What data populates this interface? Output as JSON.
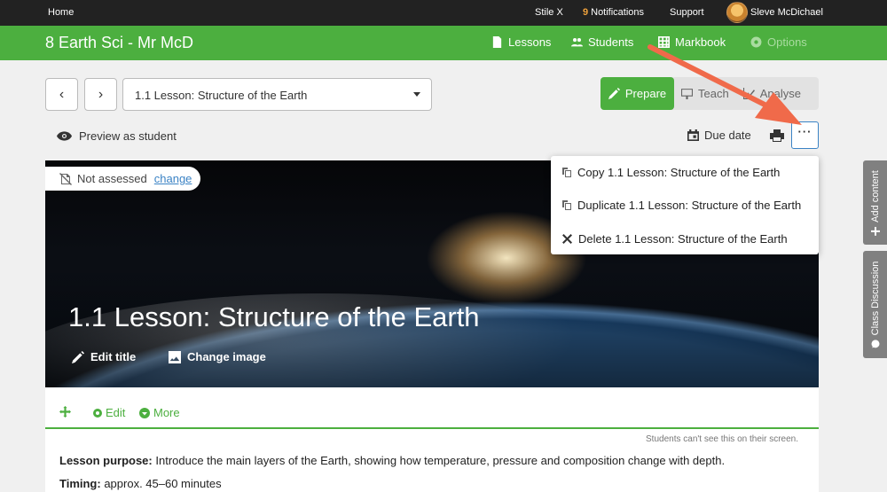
{
  "topbar": {
    "home": "Home",
    "stilex": "Stile X",
    "notif_count": "9",
    "notifications": "Notifications",
    "support": "Support",
    "user": "Sleve McDichael"
  },
  "greenbar": {
    "course": "8 Earth Sci - Mr McD",
    "lessons": "Lessons",
    "students": "Students",
    "markbook": "Markbook",
    "options": "Options"
  },
  "selector": {
    "lesson": "1.1 Lesson: Structure of the Earth",
    "modes": [
      "Prepare",
      "Teach",
      "Analyse"
    ]
  },
  "actions": {
    "preview": "Preview as student",
    "due_date": "Due date",
    "more": "···"
  },
  "menu": {
    "copy": "Copy 1.1 Lesson: Structure of the Earth",
    "duplicate": "Duplicate 1.1 Lesson: Structure of the Earth",
    "delete": "Delete 1.1 Lesson: Structure of the Earth"
  },
  "banner": {
    "assessed": "Not assessed",
    "change": "change",
    "title": "1.1 Lesson: Structure of the Earth",
    "edit_title": "Edit title",
    "change_image": "Change image"
  },
  "content": {
    "edit": "Edit",
    "more": "More",
    "hint": "Students can't see this on their screen.",
    "purpose_label": "Lesson purpose:",
    "purpose_text": " Introduce the main layers of the Earth, showing how temperature, pressure and composition change with depth.",
    "timing_label": "Timing:",
    "timing_text": " approx. 45–60 minutes"
  },
  "sidetabs": {
    "add_content": "Add content",
    "class_discussion": "Class Discussion"
  },
  "colors": {
    "brand_green": "#4caf3f",
    "top_bar": "#222222",
    "link_blue": "#3b83c5",
    "annotation_arrow": "#f06a4a"
  }
}
